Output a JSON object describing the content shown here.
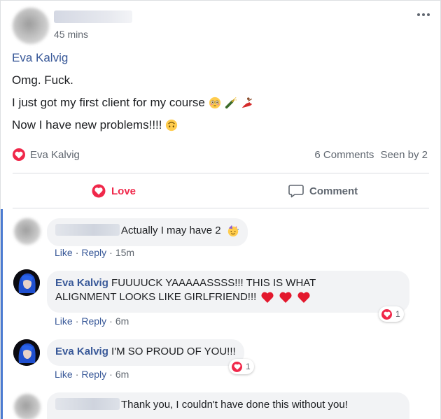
{
  "post": {
    "timestamp": "45 mins",
    "mentioned_name": "Eva Kalvig",
    "lines": [
      "Omg. Fuck.",
      "I just got my first client for my course",
      "Now I have new problems!!!!"
    ],
    "reaction_name": "Eva Kalvig",
    "comments_count": "6 Comments",
    "seen_by": "Seen by 2",
    "love_label": "Love",
    "comment_label": "Comment"
  },
  "comments": [
    {
      "text": "Actually I may have 2",
      "like": "Like",
      "reply": "Reply",
      "time": "15m"
    },
    {
      "name": "Eva Kalvig",
      "text": "FUUUUCK YAAAAASSSS!!! THIS IS WHAT",
      "text2": "ALIGNMENT LOOKS LIKE GIRLFRIEND!!!",
      "like": "Like",
      "reply": "Reply",
      "time": "6m",
      "reactions": "1"
    },
    {
      "name": "Eva Kalvig",
      "text": "I'M SO PROUD OF YOU!!!",
      "like": "Like",
      "reply": "Reply",
      "time": "6m",
      "reactions": "1"
    },
    {
      "text": "Thank you, I couldn't have done this without you!"
    }
  ],
  "colors": {
    "love": "#f0284a",
    "link": "#385898",
    "thread": "#4b7bd1"
  },
  "icons": [
    "more-options-icon",
    "flushed-emoji",
    "champagne-emoji",
    "dancer-emoji",
    "upside-down-face-emoji",
    "love-reaction-icon",
    "comment-icon",
    "heart-emoji"
  ]
}
